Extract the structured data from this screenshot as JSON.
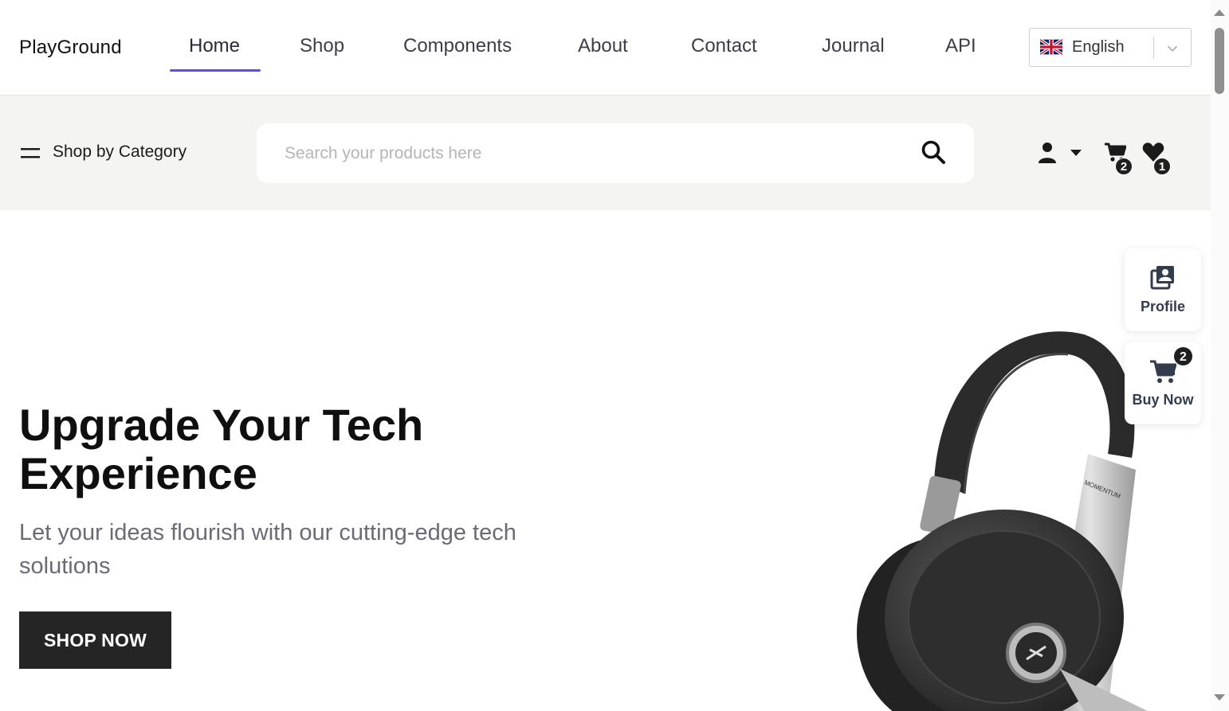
{
  "brand": "PlayGround",
  "nav": {
    "items": [
      {
        "label": "Home",
        "active": true
      },
      {
        "label": "Shop",
        "active": false
      },
      {
        "label": "Components",
        "active": false
      },
      {
        "label": "About",
        "active": false
      },
      {
        "label": "Contact",
        "active": false
      },
      {
        "label": "Journal",
        "active": false
      },
      {
        "label": "API",
        "active": false
      }
    ],
    "accent_color": "#5b50d6"
  },
  "language": {
    "selected": "English",
    "flag_icon": "uk-flag-icon"
  },
  "category": {
    "label": "Shop by Category",
    "icon": "hamburger-icon"
  },
  "search": {
    "placeholder": "Search your products here",
    "value": "",
    "icon": "search-icon"
  },
  "header_actions": {
    "user_icon": "user-icon",
    "cart": {
      "icon": "cart-icon",
      "count": "2"
    },
    "wishlist": {
      "icon": "heart-icon",
      "count": "1"
    }
  },
  "hero": {
    "title": "Upgrade Your Tech Experience",
    "subtitle": "Let your ideas flourish with our cutting-edge tech solutions",
    "cta": "SHOP NOW",
    "image": "headphones-image",
    "image_text": "MOMENTUM"
  },
  "floating": {
    "profile": {
      "label": "Profile",
      "icon": "profile-icon"
    },
    "buy_now": {
      "label": "Buy Now",
      "icon": "cart-icon",
      "count": "2"
    }
  }
}
